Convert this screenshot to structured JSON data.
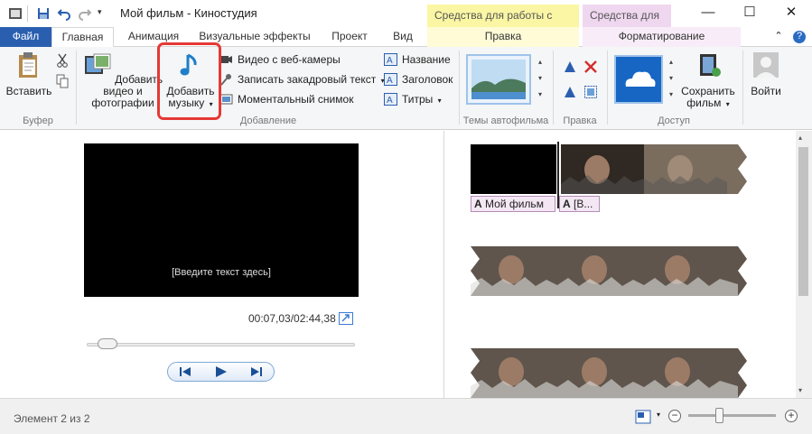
{
  "window": {
    "title": "Мой фильм - Киностудия",
    "context_tab_video": "Средства для работы с видео",
    "context_tab_text": "Средства для ...",
    "minimize": "—",
    "maximize": "☐",
    "close": "✕"
  },
  "tabs": {
    "file": "Файл",
    "items": [
      "Главная",
      "Анимация",
      "Визуальные эффекты",
      "Проект",
      "Вид"
    ],
    "video_sub": "Правка",
    "text_sub": "Форматирование",
    "help": "?"
  },
  "ribbon": {
    "clipboard": {
      "paste": "Вставить",
      "group": "Буфер"
    },
    "add": {
      "add_video": "Добавить видео и фотографии",
      "add_music": "Добавить музыку",
      "webcam": "Видео с веб-камеры",
      "narration": "Записать закадровый текст",
      "snapshot": "Моментальный снимок",
      "title": "Название",
      "caption": "Заголовок",
      "credits": "Титры",
      "group": "Добавление"
    },
    "themes": {
      "group": "Темы автофильма"
    },
    "edit": {
      "group": "Правка"
    },
    "share": {
      "save_movie": "Сохранить фильм",
      "group": "Доступ"
    },
    "signin": {
      "label": "Войти"
    }
  },
  "preview": {
    "caption_placeholder": "[Введите текст здесь]",
    "timecode": "00:07,03/02:44,38",
    "position_fraction": 0.043
  },
  "timeline": {
    "caption_chip_1": "Мой фильм",
    "caption_chip_2": "[В..."
  },
  "status": {
    "text": "Элемент 2 из 2"
  },
  "colors": {
    "file_tab": "#2a5fb0",
    "ctx_video": "#fbf6a4",
    "ctx_text": "#efd7ef",
    "highlight": "#e53935"
  }
}
